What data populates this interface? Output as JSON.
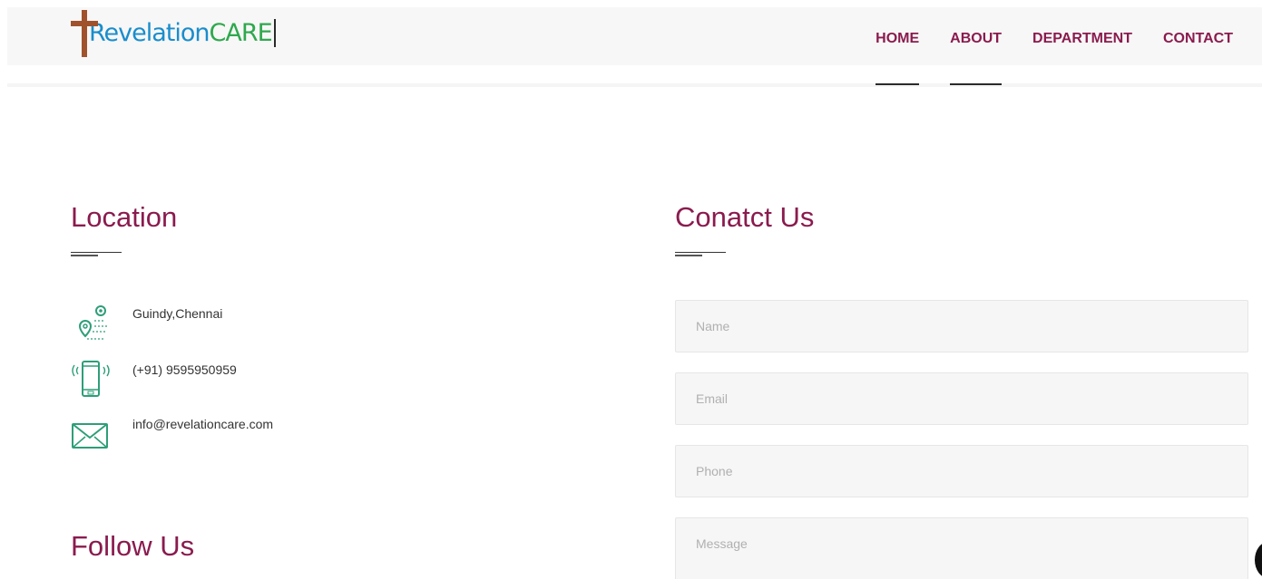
{
  "brand": {
    "name_part1": "Revelation",
    "name_part2": "CARE",
    "colors": {
      "cross": "#a0522d",
      "part1": "#1a8dcc",
      "part2": "#2ea84d"
    }
  },
  "nav": {
    "items": [
      {
        "label": "HOME"
      },
      {
        "label": "ABOUT"
      },
      {
        "label": "DEPARTMENT"
      },
      {
        "label": "CONTACT"
      }
    ]
  },
  "location": {
    "title": "Location",
    "items": [
      {
        "icon": "location-route-icon",
        "text": "Guindy,Chennai"
      },
      {
        "icon": "mobile-phone-icon",
        "text": "(+91) 9595950959"
      },
      {
        "icon": "envelope-icon",
        "text": "info@revelationcare.com"
      }
    ]
  },
  "follow": {
    "title": "Follow Us"
  },
  "contact_form": {
    "title": "Conatct Us",
    "name_placeholder": "Name",
    "email_placeholder": "Email",
    "phone_placeholder": "Phone",
    "message_placeholder": "Message"
  },
  "theme": {
    "accent": "#8a1b4e",
    "icon_green": "#2e9e78"
  }
}
